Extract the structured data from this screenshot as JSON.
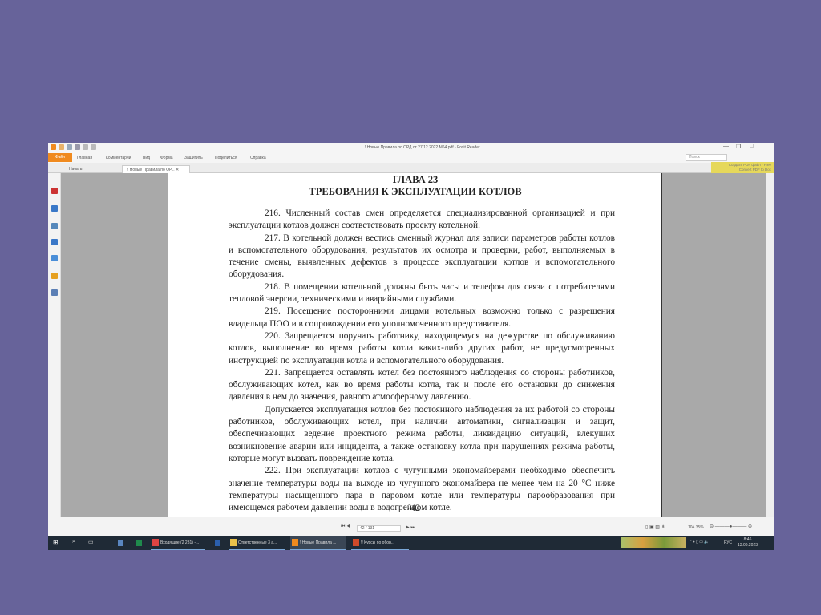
{
  "window": {
    "title": "! Новые Правила по ОРД от 27.12.2022 М64.pdf - Foxit Reader"
  },
  "ribbon": {
    "file": "Файл",
    "tabs": [
      "Главная",
      "Комментарий",
      "Вид",
      "Форма",
      "Защитить",
      "Поделиться",
      "Справка"
    ],
    "search_placeholder": "Поиск"
  },
  "doc_tabs": [
    "Начать",
    "! Новые Правила по ОР..."
  ],
  "promo": {
    "line1": "Создать PDF файл - Free",
    "line2": "Convert PDF to Doc"
  },
  "document": {
    "chapter": "ГЛАВА 23",
    "heading": "ТРЕБОВАНИЯ К ЭКСПЛУАТАЦИИ КОТЛОВ",
    "paragraphs": [
      "216. Численный состав смен определяется специализированной организацией и при эксплуатации котлов должен соответствовать проекту котельной.",
      "217. В котельной должен вестись сменный журнал для записи параметров работы котлов и вспомогательного оборудования, результатов их осмотра и проверки, работ, выполняемых в течение смены, выявленных дефектов в процессе эксплуатации котлов и вспомогательного оборудования.",
      "218. В помещении котельной должны быть часы и телефон для связи с потребителями тепловой энергии, техническими и аварийными службами.",
      "219. Посещение посторонними лицами котельных возможно только с разрешения владельца ПОО и в сопровождении его уполномоченного представителя.",
      "220. Запрещается поручать работнику, находящемуся на дежурстве по обслуживанию котлов, выполнение во время работы котла каких-либо других работ, не предусмотренных инструкцией по эксплуатации котла и вспомогательного оборудования.",
      "221. Запрещается оставлять котел без постоянного наблюдения со стороны работников, обслуживающих котел, как во время работы котла, так и после его остановки до снижения давления в нем до значения, равного атмосферному давлению.",
      "Допускается эксплуатация котлов без постоянного наблюдения за их работой со стороны работников, обслуживающих котел, при наличии автоматики, сигнализации и защит, обеспечивающих ведение проектного режима работы, ликвидацию ситуаций, влекущих возникновение аварии или инцидента, а также остановку котла при нарушениях режима работы, которые могут вызвать повреждение котла.",
      "222. При эксплуатации котлов с чугунными экономайзерами необходимо обеспечить значение температуры воды на выходе из чугунного экономайзера не менее чем на 20 °С ниже температуры насыщенного пара в паровом котле или температуры парообразования при имеющемся рабочем давлении воды в водогрейном котле."
    ],
    "page_number": "42"
  },
  "status": {
    "page_field": "42 / 131",
    "zoom": "104.35%"
  },
  "taskbar": {
    "items": [
      "Входящие (2 231) -...",
      "Ответственные 3 а...",
      "! Новые Правила ...",
      "!! Курсы по обор..."
    ],
    "lang": "РУС",
    "time": "8:46",
    "date": "13.06.2023"
  }
}
